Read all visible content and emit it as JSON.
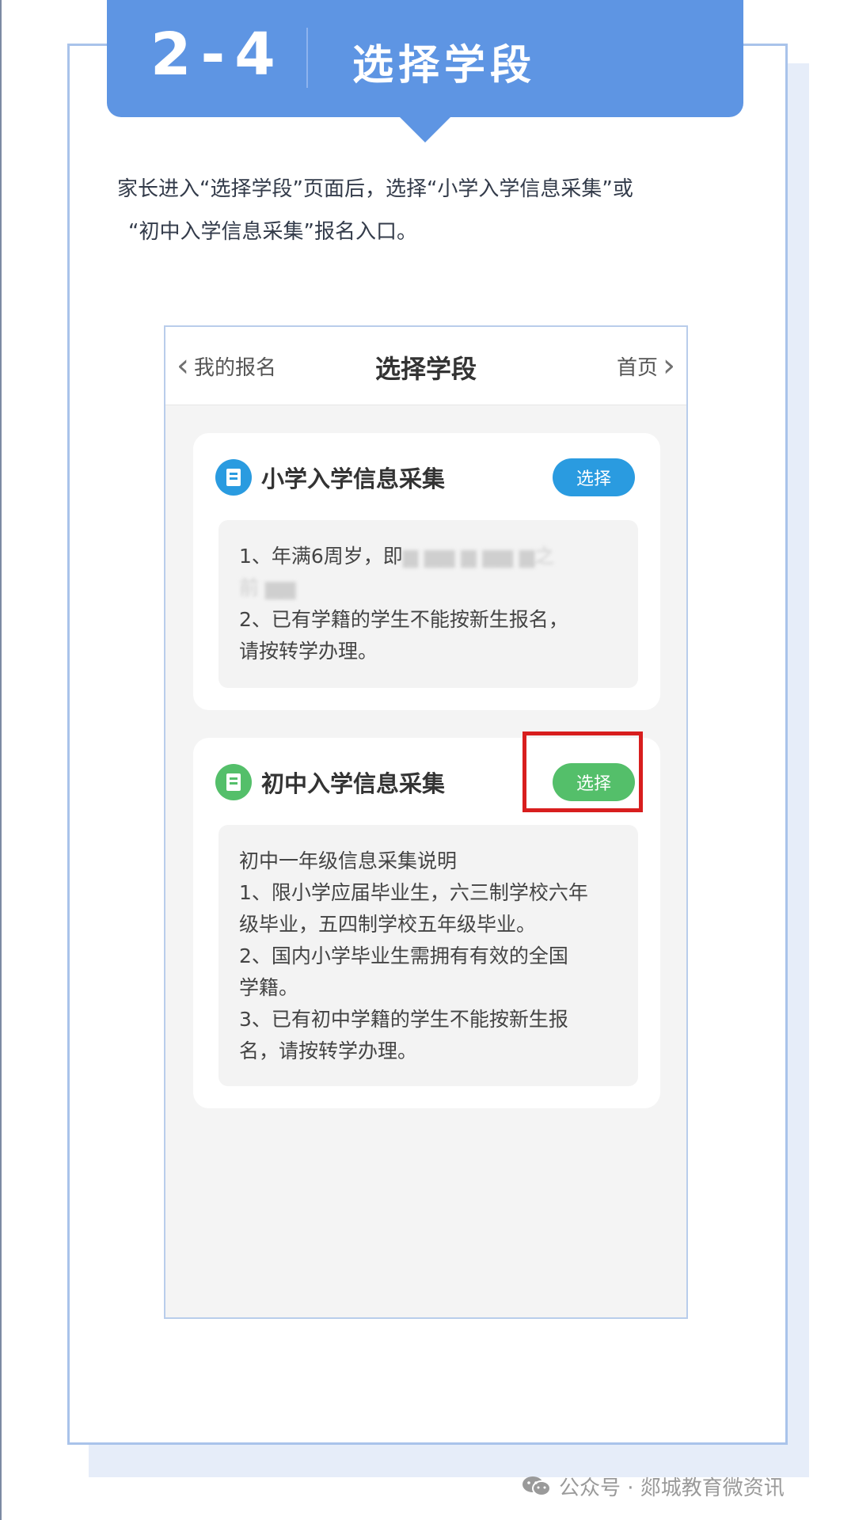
{
  "header": {
    "step_number": "2-4",
    "title": "选择学段"
  },
  "intro": {
    "line1": "家长进入“选择学段”页面后，选择“小学入学信息采集”或",
    "line2": "“初中入学信息采集”报名入口。"
  },
  "phone": {
    "navbar": {
      "back_label": "我的报名",
      "title": "选择学段",
      "home_label": "首页"
    },
    "cards": [
      {
        "title": "小学入学信息采集",
        "button_label": "选择",
        "accent": "#2a9be0",
        "lines": [
          "1、年满6周岁，即",
          "2、已有学籍的学生不能按新生报名，",
          "请按转学办理。"
        ]
      },
      {
        "title": "初中入学信息采集",
        "button_label": "选择",
        "accent": "#54bf6a",
        "lines": [
          "初中一年级信息采集说明",
          "1、限小学应届毕业生，六三制学校六年",
          "级毕业，五四制学校五年级毕业。",
          "2、国内小学毕业生需拥有有效的全国",
          "学籍。",
          "3、已有初中学籍的学生不能按新生报",
          "名，请按转学办理。"
        ]
      }
    ]
  },
  "watermark": {
    "text": "公众号 · 郯城教育微资讯",
    "icon": "wechat-icon"
  },
  "colors": {
    "banner": "#5e95e3",
    "highlight": "#d81e1e",
    "frame_border": "#a9c3ea"
  }
}
